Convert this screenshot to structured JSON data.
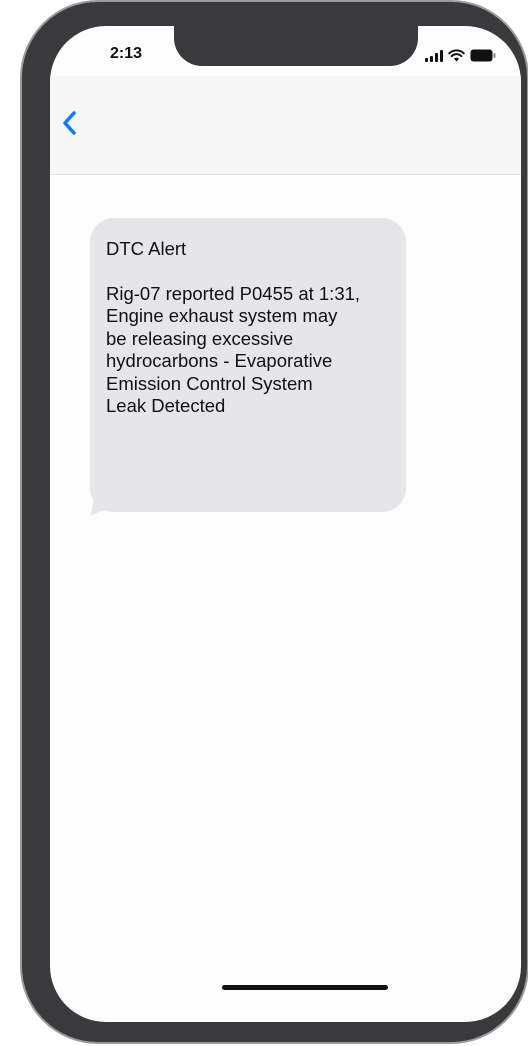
{
  "status_bar": {
    "time": "2:13",
    "icons": [
      "signal-icon",
      "wifi-icon",
      "battery-icon"
    ]
  },
  "nav": {
    "back_icon": "chevron-left-icon",
    "accent_color": "#0a7aff"
  },
  "message": {
    "title": "DTC Alert",
    "body": "Rig-07 reported P0455 at 1:31,\nEngine exhaust system may\nbe releasing excessive\nhydrocarbons - Evaporative\nEmission Control System\nLeak Detected",
    "bubble_color": "#e5e5ea"
  }
}
